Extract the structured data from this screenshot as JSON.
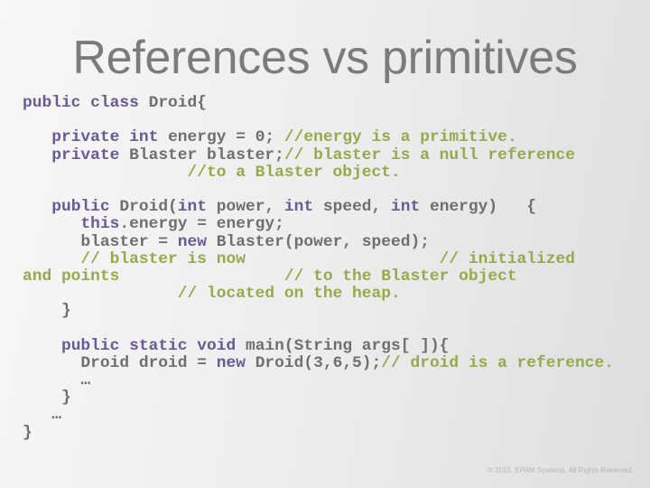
{
  "slide": {
    "title": "References vs primitives",
    "footer": "© 2015, EPAM Systems. All Rights Reserved."
  },
  "colors": {
    "title": "#7b7b7b",
    "code_plain": "#6f6f6f",
    "code_keyword": "#6a5a94",
    "code_comment": "#92ab4c",
    "background_left": "#f7f7f7",
    "background_right": "#dedede"
  },
  "code": {
    "language": "Java",
    "lines": [
      [
        {
          "t": "kw",
          "s": "public class "
        },
        {
          "t": "pl",
          "s": "Droid{"
        }
      ],
      [],
      [
        {
          "t": "pl",
          "s": "   "
        },
        {
          "t": "kw",
          "s": "private int "
        },
        {
          "t": "pl",
          "s": "energy = 0; "
        },
        {
          "t": "cm",
          "s": "//energy is a primitive."
        }
      ],
      [
        {
          "t": "pl",
          "s": "   "
        },
        {
          "t": "kw",
          "s": "private "
        },
        {
          "t": "pl",
          "s": "Blaster blaster;"
        },
        {
          "t": "cm",
          "s": "// blaster is a null reference"
        }
      ],
      [
        {
          "t": "pl",
          "s": "                 "
        },
        {
          "t": "cm",
          "s": "//to a Blaster object."
        }
      ],
      [],
      [
        {
          "t": "pl",
          "s": "   "
        },
        {
          "t": "kw",
          "s": "public "
        },
        {
          "t": "pl",
          "s": "Droid("
        },
        {
          "t": "kw",
          "s": "int "
        },
        {
          "t": "pl",
          "s": "power, "
        },
        {
          "t": "kw",
          "s": "int "
        },
        {
          "t": "pl",
          "s": "speed, "
        },
        {
          "t": "kw",
          "s": "int "
        },
        {
          "t": "pl",
          "s": "energy)   {"
        }
      ],
      [
        {
          "t": "pl",
          "s": "      "
        },
        {
          "t": "kw",
          "s": "this"
        },
        {
          "t": "pl",
          "s": ".energy = energy;"
        }
      ],
      [
        {
          "t": "pl",
          "s": "      blaster = "
        },
        {
          "t": "kw",
          "s": "new "
        },
        {
          "t": "pl",
          "s": "Blaster(power, speed);"
        }
      ],
      [
        {
          "t": "pl",
          "s": "      "
        },
        {
          "t": "cm",
          "s": "// blaster is now                    // initialized"
        }
      ],
      [
        {
          "t": "cm",
          "s": "and points                 // to the Blaster object"
        }
      ],
      [
        {
          "t": "pl",
          "s": "                "
        },
        {
          "t": "cm",
          "s": "// located on the heap."
        }
      ],
      [
        {
          "t": "pl",
          "s": "    }"
        }
      ],
      [],
      [
        {
          "t": "pl",
          "s": "    "
        },
        {
          "t": "kw",
          "s": "public static void "
        },
        {
          "t": "pl",
          "s": "main(String args[ ]){"
        }
      ],
      [
        {
          "t": "pl",
          "s": "      Droid droid = "
        },
        {
          "t": "kw",
          "s": "new "
        },
        {
          "t": "pl",
          "s": "Droid(3,6,5);"
        },
        {
          "t": "cm",
          "s": "// droid is a reference."
        }
      ],
      [
        {
          "t": "pl",
          "s": "      …"
        }
      ],
      [
        {
          "t": "pl",
          "s": "    }"
        }
      ],
      [
        {
          "t": "pl",
          "s": "   …"
        }
      ],
      [
        {
          "t": "pl",
          "s": "}"
        }
      ]
    ]
  }
}
